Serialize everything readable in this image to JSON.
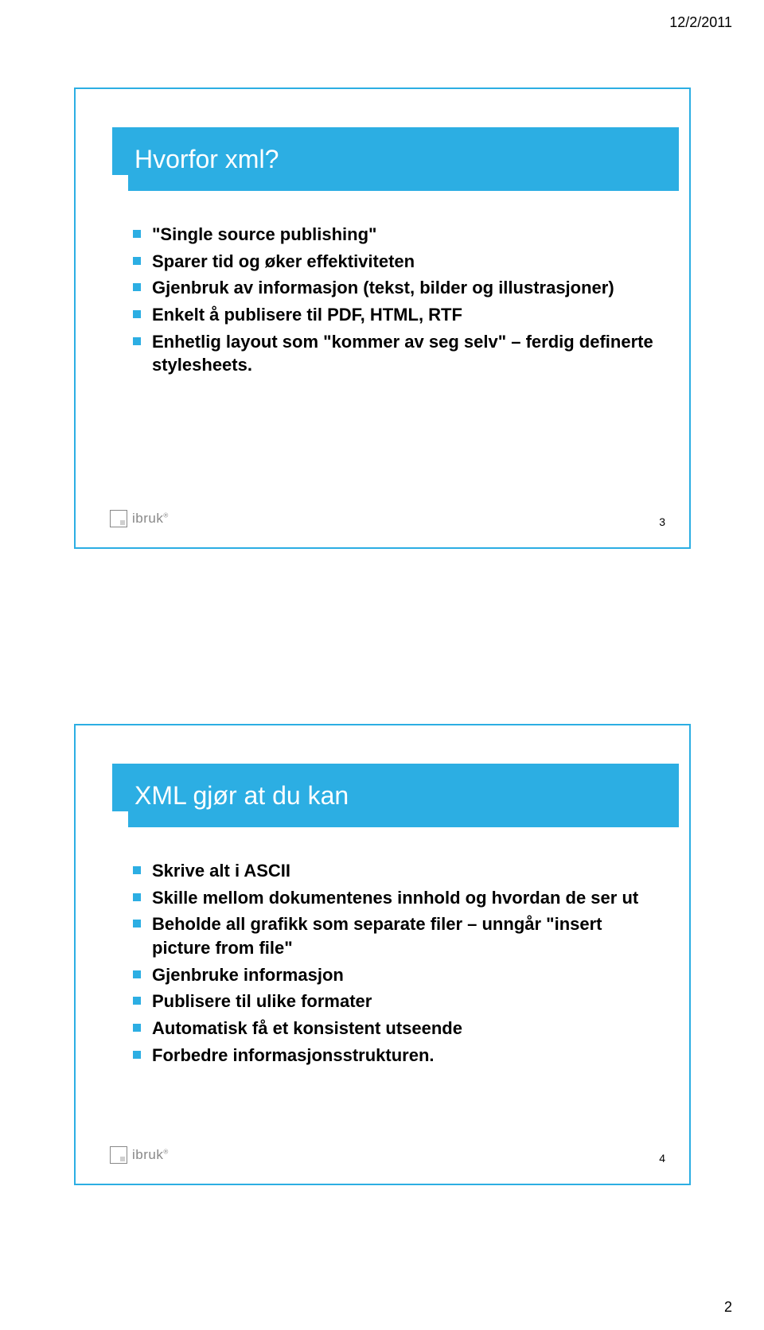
{
  "header": {
    "date": "12/2/2011"
  },
  "footer": {
    "page_number": "2"
  },
  "slides": [
    {
      "title": "Hvorfor xml?",
      "bullets": [
        "\"Single source publishing\"",
        "Sparer tid og øker effektiviteten",
        "Gjenbruk av informasjon (tekst, bilder og illustrasjoner)",
        "Enkelt å publisere til PDF, HTML, RTF",
        "Enhetlig layout som \"kommer av seg selv\" – ferdig definerte stylesheets."
      ],
      "slide_number": "3",
      "logo_text": "ibruk"
    },
    {
      "title": "XML gjør at du kan",
      "bullets": [
        "Skrive alt i ASCII",
        "Skille mellom dokumentenes innhold og hvordan de ser ut",
        "Beholde all grafikk som separate filer – unngår \"insert picture from file\"",
        "Gjenbruke informasjon",
        "Publisere til ulike formater",
        "Automatisk få et konsistent utseende",
        "Forbedre informasjonsstrukturen."
      ],
      "slide_number": "4",
      "logo_text": "ibruk"
    }
  ]
}
